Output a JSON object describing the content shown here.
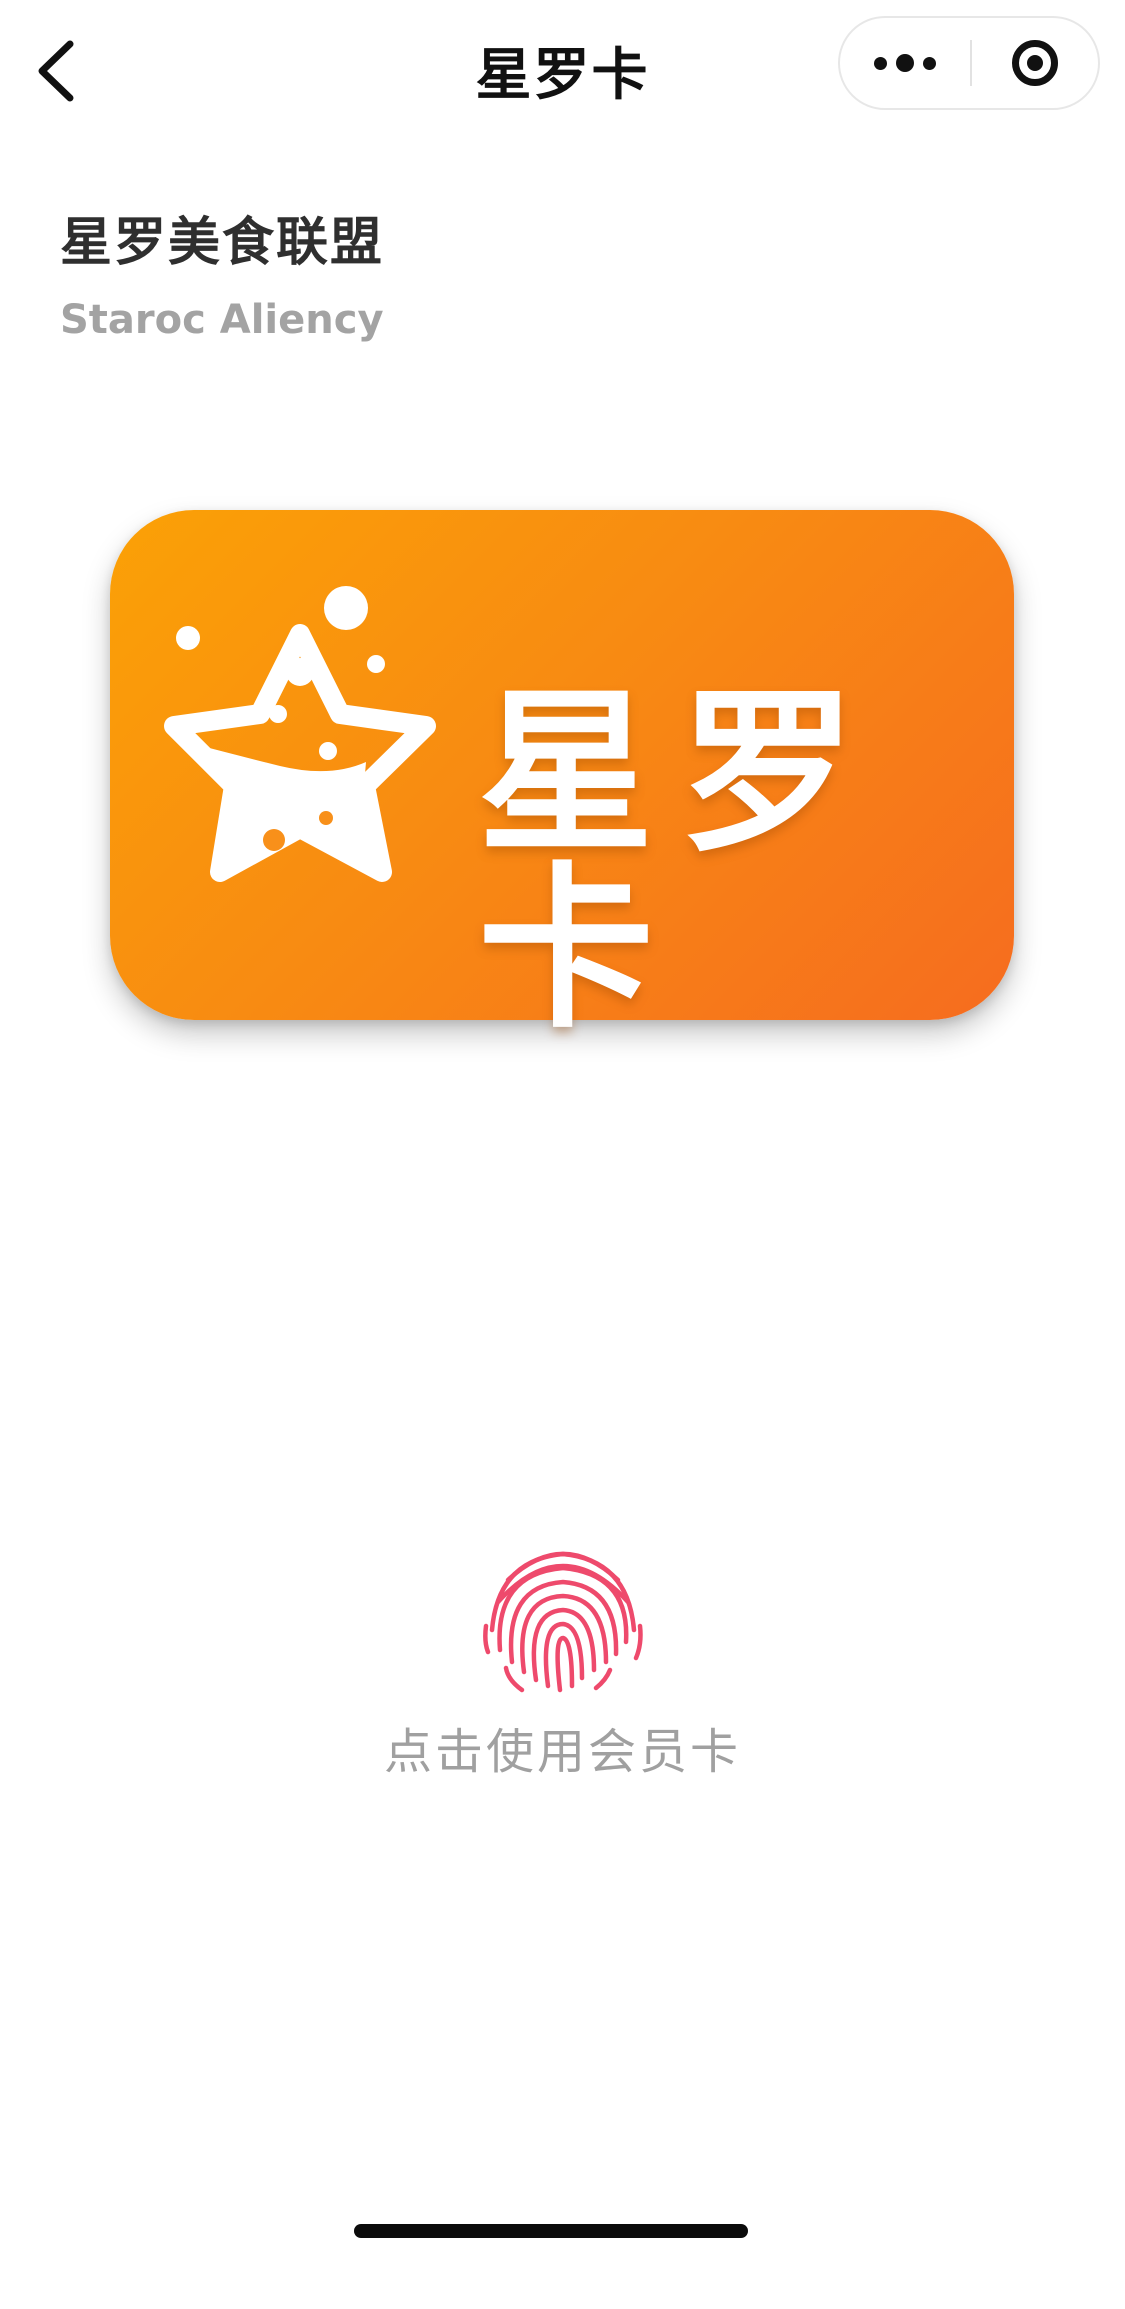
{
  "nav": {
    "title": "星罗卡"
  },
  "merchant": {
    "name": "星罗美食联盟",
    "subtitle": "Staroc Aliency"
  },
  "card": {
    "title": "星罗卡",
    "logo_icon": "star-flask-logo",
    "gradient_start": "#fba106",
    "gradient_end": "#f66c1f"
  },
  "action": {
    "label": "点击使用会员卡",
    "icon": "fingerprint-icon",
    "icon_color": "#ee4a6c"
  }
}
